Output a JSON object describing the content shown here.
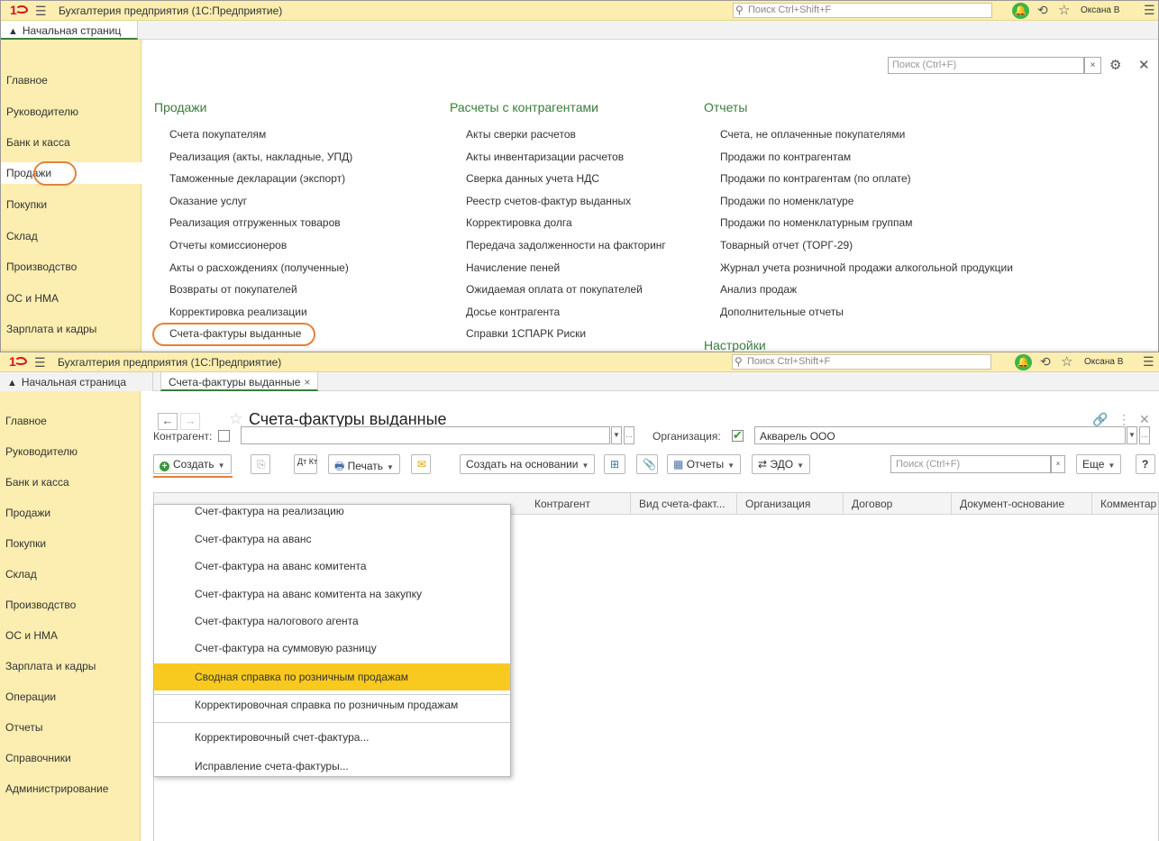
{
  "app": {
    "logo": "1С",
    "title": "Бухгалтерия предприятия  (1С:Предприятие)",
    "search_placeholder": "Поиск Ctrl+Shift+F",
    "user": "Оксана В"
  },
  "tabs": {
    "home": "Начальная страница",
    "home_truncated": "Начальная страниц",
    "invoices": "Счета-фактуры выданные"
  },
  "sidebar_back": [
    "Главное",
    "Руководителю",
    "Банк и касса",
    "Продажи",
    "Покупки",
    "Склад",
    "Производство",
    "ОС и НМА",
    "Зарплата и кадры"
  ],
  "sidebar_front": [
    "Главное",
    "Руководителю",
    "Банк и касса",
    "Продажи",
    "Покупки",
    "Склад",
    "Производство",
    "ОС и НМА",
    "Зарплата и кадры",
    "Операции",
    "Отчеты",
    "Справочники",
    "Администрирование"
  ],
  "panel": {
    "search_placeholder": "Поиск (Ctrl+F)",
    "col1": {
      "title": "Продажи",
      "items": [
        "Счета покупателям",
        "Реализация (акты, накладные, УПД)",
        "Таможенные декларации (экспорт)",
        "Оказание услуг",
        "Реализация отгруженных товаров",
        "Отчеты комиссионеров",
        "Акты о расхождениях (полученные)",
        "Возвраты от покупателей",
        "Корректировка реализации",
        "Счета-фактуры выданные"
      ]
    },
    "col2": {
      "title": "Расчеты с контрагентами",
      "items": [
        "Акты сверки расчетов",
        "Акты инвентаризации расчетов",
        "Сверка данных учета НДС",
        "Реестр счетов-фактур выданных",
        "Корректировка долга",
        "Передача задолженности на факторинг",
        "Начисление пеней",
        "Ожидаемая оплата от покупателей",
        "Досье контрагента",
        "Справки 1СПАРК Риски"
      ]
    },
    "col3": {
      "title": "Отчеты",
      "items": [
        "Счета, не оплаченные покупателями",
        "Продажи по контрагентам",
        "Продажи по контрагентам (по оплате)",
        "Продажи по номенклатуре",
        "Продажи по номенклатурным группам",
        "Товарный отчет (ТОРГ-29)",
        "Журнал учета розничной продажи алкогольной продукции",
        "Анализ продаж",
        "Дополнительные отчеты"
      ],
      "settings": "Настройки"
    }
  },
  "form": {
    "title": "Счета-фактуры выданные",
    "counterparty_label": "Контрагент:",
    "counterparty_value": "",
    "org_label": "Организация:",
    "org_value": "Акварель ООО",
    "toolbar": {
      "create": "Создать",
      "dtkt": "Дт Кт",
      "print": "Печать",
      "create_based": "Создать на основании",
      "reports": "Отчеты",
      "edo": "ЭДО",
      "search_placeholder": "Поиск (Ctrl+F)",
      "more": "Еще",
      "help": "?"
    },
    "columns": [
      "Контрагент",
      "Вид счета-факт...",
      "Организация",
      "Договор",
      "Документ-основание",
      "Комментар"
    ],
    "create_menu": [
      "Счет-фактура на реализацию",
      "Счет-фактура на аванс",
      "Счет-фактура на аванс комитента",
      "Счет-фактура на аванс комитента на закупку",
      "Счет-фактура налогового агента",
      "Счет-фактура на суммовую разницу",
      "Сводная справка по розничным продажам",
      "Корректировочная справка по розничным продажам",
      "Корректировочный счет-фактура...",
      "Исправление счета-фактуры..."
    ]
  },
  "colors": {
    "header_bg": "#fbeeb0",
    "accent_green": "#3b7d3b",
    "highlight": "#f8c91f",
    "ring": "#e2823a"
  }
}
